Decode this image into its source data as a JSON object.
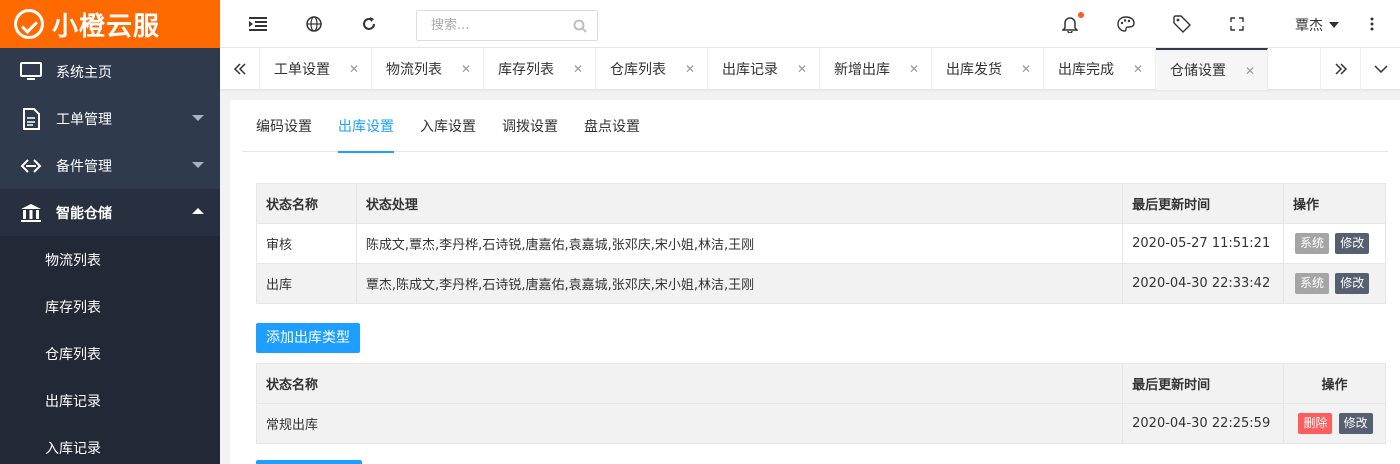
{
  "brand": {
    "name": "小橙云服",
    "color": "#ff6a00"
  },
  "sidebar": {
    "items": [
      {
        "label": "系统主页",
        "icon": "monitor-icon"
      },
      {
        "label": "工单管理",
        "icon": "document-icon"
      },
      {
        "label": "备件管理",
        "icon": "link-icon"
      },
      {
        "label": "智能仓储",
        "icon": "bank-icon"
      }
    ],
    "submenu": [
      "物流列表",
      "库存列表",
      "仓库列表",
      "出库记录",
      "入库记录"
    ]
  },
  "topbar": {
    "search_placeholder": "搜索...",
    "username": "覃杰"
  },
  "tabs": [
    "工单设置",
    "物流列表",
    "库存列表",
    "仓库列表",
    "出库记录",
    "新增出库",
    "出库发货",
    "出库完成",
    "仓储设置"
  ],
  "subtabs": [
    "编码设置",
    "出库设置",
    "入库设置",
    "调拨设置",
    "盘点设置"
  ],
  "table1": {
    "headers": [
      "状态名称",
      "状态处理",
      "最后更新时间",
      "操作"
    ],
    "rows": [
      {
        "name": "审核",
        "handlers": "陈成文,覃杰,李丹桦,石诗锐,唐嘉佑,袁嘉城,张邓庆,宋小姐,林洁,王刚",
        "time": "2020-05-27 11:51:21",
        "btn1": "系统",
        "btn2": "修改"
      },
      {
        "name": "出库",
        "handlers": "覃杰,陈成文,李丹桦,石诗锐,唐嘉佑,袁嘉城,张邓庆,宋小姐,林洁,王刚",
        "time": "2020-04-30 22:33:42",
        "btn1": "系统",
        "btn2": "修改"
      }
    ]
  },
  "add_button": "添加出库类型",
  "table2": {
    "headers": [
      "状态名称",
      "最后更新时间",
      "操作"
    ],
    "rows": [
      {
        "name": "常规出库",
        "time": "2020-04-30 22:25:59",
        "btn1": "删除",
        "btn2": "修改"
      }
    ]
  }
}
